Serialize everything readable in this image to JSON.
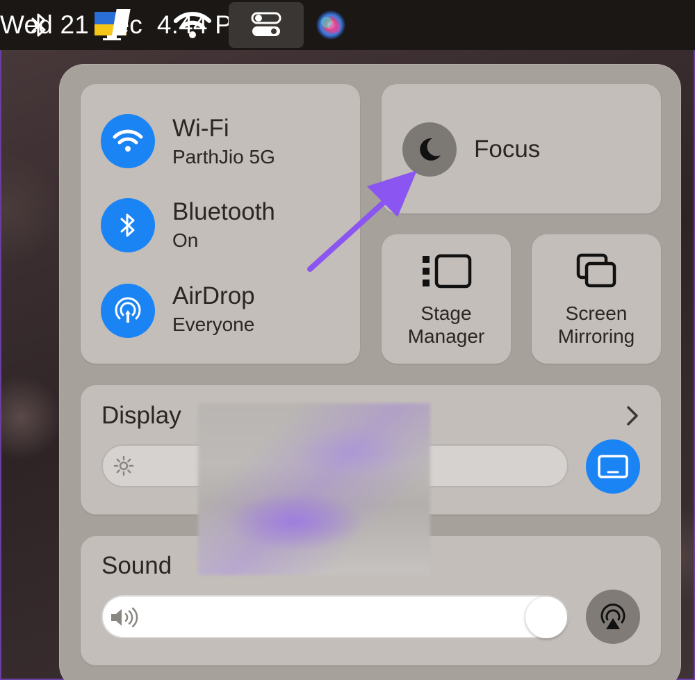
{
  "menubar": {
    "items": [
      {
        "icon": "bluetooth-icon"
      },
      {
        "icon": "display-flag-icon"
      },
      {
        "icon": "wifi-icon"
      },
      {
        "icon": "control-center-icon"
      },
      {
        "icon": "siri-icon"
      }
    ],
    "date": "Wed 21 Dec",
    "time": "4:44 PM"
  },
  "control_center": {
    "connectivity": [
      {
        "label": "Wi-Fi",
        "status": "ParthJio 5G",
        "icon": "wifi-icon"
      },
      {
        "label": "Bluetooth",
        "status": "On",
        "icon": "bluetooth-icon"
      },
      {
        "label": "AirDrop",
        "status": "Everyone",
        "icon": "airdrop-icon"
      }
    ],
    "focus": {
      "label": "Focus",
      "icon": "moon-icon"
    },
    "stage_manager": {
      "label_line1": "Stage",
      "label_line2": "Manager",
      "icon": "stage-manager-icon"
    },
    "screen_mirroring": {
      "label_line1": "Screen",
      "label_line2": "Mirroring",
      "icon": "screen-mirroring-icon"
    },
    "display": {
      "title": "Display",
      "icon": "sun-icon",
      "button_icon": "display-icon"
    },
    "sound": {
      "title": "Sound",
      "icon": "speaker-icon",
      "button_icon": "airplay-audio-icon",
      "volume": 0.95
    }
  },
  "colors": {
    "accent_blue": "#1a84f5",
    "annotation_arrow": "#8a55f0",
    "menubar": "#1b1714"
  }
}
